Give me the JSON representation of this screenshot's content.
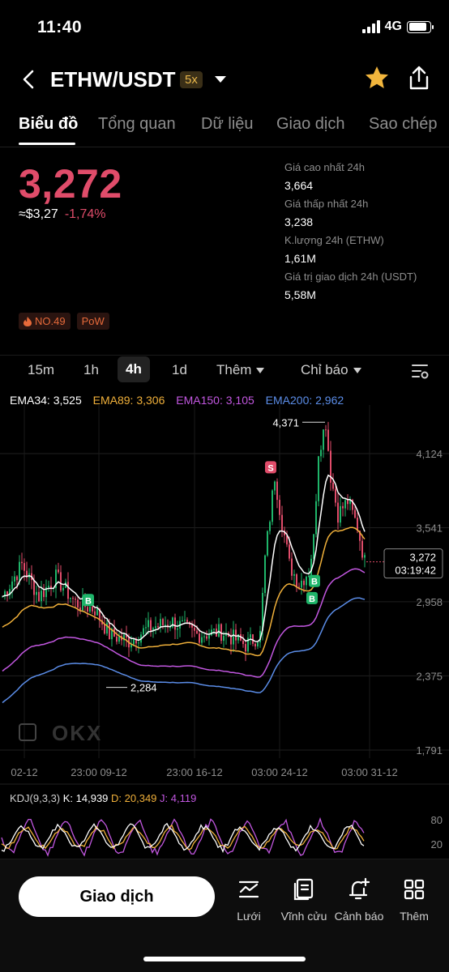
{
  "status": {
    "time": "11:40",
    "network": "4G"
  },
  "header": {
    "pair": "ETHW/USDT",
    "leverage": "5x"
  },
  "tabs": [
    "Biểu đồ",
    "Tổng quan",
    "Dữ liệu",
    "Giao dịch",
    "Sao chép"
  ],
  "price": {
    "last": "3,272",
    "approx": "≈$3,27",
    "change": "-1,74%"
  },
  "stats": [
    {
      "label": "Giá cao nhất 24h",
      "value": "3,664"
    },
    {
      "label": "Giá thấp nhất 24h",
      "value": "3,238"
    },
    {
      "label": "K.lượng 24h (ETHW)",
      "value": "1,61M"
    },
    {
      "label": "Giá trị giao dịch 24h (USDT)",
      "value": "5,58M"
    }
  ],
  "badges": {
    "rank": "NO.49",
    "consensus": "PoW"
  },
  "timeframes": {
    "m15": "15m",
    "h1": "1h",
    "h4": "4h",
    "d1": "1d",
    "more": "Thêm",
    "indicators": "Chỉ báo"
  },
  "ema": {
    "e34": "EMA34: 3,525",
    "e89": "EMA89: 3,306",
    "e150": "EMA150: 3,105",
    "e200": "EMA200: 2,962"
  },
  "colors": {
    "up": "#1fb56a",
    "down": "#e04c6a",
    "ema34": "#ffffff",
    "ema89": "#f0b03a",
    "ema150": "#c257e0",
    "ema200": "#5b8de8"
  },
  "chart_data": {
    "type": "candlestick",
    "pair": "ETHW/USDT",
    "interval": "4h",
    "x_ticks": [
      "02-12",
      "23:00 09-12",
      "23:00 16-12",
      "03:00 24-12",
      "03:00 31-12"
    ],
    "y_ticks": [
      "4,124",
      "3,541",
      "2,958",
      "2,375",
      "1,791"
    ],
    "ylim": [
      1791,
      4400
    ],
    "high_label": "4,371",
    "low_label": "2,284",
    "current_price": "3,272",
    "countdown": "03:19:42",
    "signals": [
      {
        "label": "B",
        "type": "buy"
      },
      {
        "label": "S",
        "type": "sell"
      },
      {
        "label": "B",
        "type": "buy"
      },
      {
        "label": "B",
        "type": "buy"
      }
    ],
    "ema_series": [
      {
        "name": "EMA34",
        "last": 3525
      },
      {
        "name": "EMA89",
        "last": 3306
      },
      {
        "name": "EMA150",
        "last": 3105
      },
      {
        "name": "EMA200",
        "last": 2962
      }
    ],
    "kdj": {
      "label": "KDJ(9,3,3)",
      "k": "K: 14,939",
      "d": "D: 20,349",
      "j": "J: 4,119",
      "ticks": [
        "80",
        "20"
      ]
    }
  },
  "bottom": {
    "trade": "Giao dịch",
    "grid": "Lưới",
    "perpetual": "Vĩnh cửu",
    "alert": "Cảnh báo",
    "more": "Thêm"
  }
}
